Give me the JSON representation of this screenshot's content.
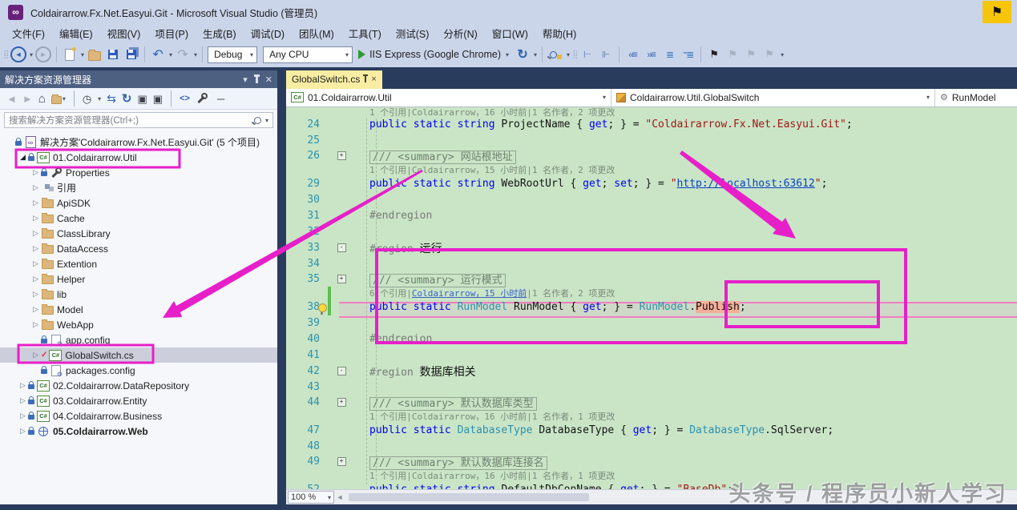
{
  "title_bar": {
    "title": "Coldairarrow.Fx.Net.Easyui.Git - Microsoft Visual Studio (管理员)"
  },
  "menu": [
    "文件(F)",
    "编辑(E)",
    "视图(V)",
    "项目(P)",
    "生成(B)",
    "调试(D)",
    "团队(M)",
    "工具(T)",
    "测试(S)",
    "分析(N)",
    "窗口(W)",
    "帮助(H)"
  ],
  "toolbar": {
    "configuration": "Debug",
    "platform": "Any CPU",
    "run_label": "IIS Express (Google Chrome)"
  },
  "solution_explorer": {
    "title": "解决方案资源管理器",
    "search_placeholder": "搜索解决方案资源管理器(Ctrl+;)",
    "tree": [
      {
        "label": "解决方案'Coldairarrow.Fx.Net.Easyui.Git' (5 个项目)",
        "icon": "sol",
        "level": 0,
        "exp": "",
        "lock": true
      },
      {
        "label": "01.Coldairarrow.Util",
        "icon": "csproj",
        "level": 1,
        "exp": "open",
        "lock": true
      },
      {
        "label": "Properties",
        "icon": "wrench",
        "level": 2,
        "exp": "closed",
        "lock": true
      },
      {
        "label": "引用",
        "icon": "refs",
        "level": 2,
        "exp": "closed"
      },
      {
        "label": "ApiSDK",
        "icon": "folder",
        "level": 2,
        "exp": "closed"
      },
      {
        "label": "Cache",
        "icon": "folder",
        "level": 2,
        "exp": "closed"
      },
      {
        "label": "ClassLibrary",
        "icon": "folder",
        "level": 2,
        "exp": "closed"
      },
      {
        "label": "DataAccess",
        "icon": "folder",
        "level": 2,
        "exp": "closed"
      },
      {
        "label": "Extention",
        "icon": "folder",
        "level": 2,
        "exp": "closed"
      },
      {
        "label": "Helper",
        "icon": "folder",
        "level": 2,
        "exp": "closed"
      },
      {
        "label": "lib",
        "icon": "folder",
        "level": 2,
        "exp": "closed"
      },
      {
        "label": "Model",
        "icon": "folder",
        "level": 2,
        "exp": "closed"
      },
      {
        "label": "WebApp",
        "icon": "folder",
        "level": 2,
        "exp": "closed"
      },
      {
        "label": "app.config",
        "icon": "config",
        "level": 2,
        "exp": "",
        "lock": true
      },
      {
        "label": "GlobalSwitch.cs",
        "icon": "cs",
        "level": 2,
        "exp": "closed",
        "check": true,
        "selected": true
      },
      {
        "label": "packages.config",
        "icon": "config",
        "level": 2,
        "exp": "",
        "lock": true
      },
      {
        "label": "02.Coldairarrow.DataRepository",
        "icon": "csproj",
        "level": 1,
        "exp": "closed",
        "lock": true
      },
      {
        "label": "03.Coldairarrow.Entity",
        "icon": "csproj",
        "level": 1,
        "exp": "closed",
        "lock": true
      },
      {
        "label": "04.Coldairarrow.Business",
        "icon": "csproj",
        "level": 1,
        "exp": "closed",
        "lock": true
      },
      {
        "label": "05.Coldairarrow.Web",
        "icon": "web",
        "level": 1,
        "exp": "closed",
        "lock": true,
        "bold": true
      }
    ]
  },
  "editor": {
    "tab": "GlobalSwitch.cs",
    "nav_project": "01.Coldairarrow.Util",
    "nav_type": "Coldairarrow.Util.GlobalSwitch",
    "nav_member": "RunModel",
    "zoom_level": "100 %",
    "rows": [
      {
        "type": "clip",
        "seg": [
          {
            "c": "cl",
            "t": "1 个引用|Coldairarrow，16 小时前|1 名作者，2 项更改"
          }
        ]
      },
      {
        "n": "24",
        "type": "code",
        "seg": [
          {
            "c": "kw",
            "t": "public static string"
          },
          {
            "c": "pl",
            "t": " ProjectName { "
          },
          {
            "c": "kw",
            "t": "get"
          },
          {
            "c": "pl",
            "t": "; } = "
          },
          {
            "c": "str",
            "t": "\"Coldairarrow.Fx.Net.Easyui.Git\""
          },
          {
            "c": "pl",
            "t": ";"
          }
        ]
      },
      {
        "n": "25",
        "type": "blank"
      },
      {
        "n": "26",
        "type": "summary",
        "fold": "+",
        "seg": [
          {
            "c": "cm",
            "t": "/// <summary> 网站根地址"
          }
        ]
      },
      {
        "type": "codelens",
        "seg": [
          {
            "c": "cl",
            "t": "1 个引用|Coldairarrow，15 小时前|1 名作者，2 项更改"
          }
        ]
      },
      {
        "n": "29",
        "type": "code",
        "seg": [
          {
            "c": "kw",
            "t": "public static string"
          },
          {
            "c": "pl",
            "t": " WebRootUrl { "
          },
          {
            "c": "kw",
            "t": "get"
          },
          {
            "c": "pl",
            "t": "; "
          },
          {
            "c": "kw",
            "t": "set"
          },
          {
            "c": "pl",
            "t": "; } = "
          },
          {
            "c": "str",
            "t": "\""
          },
          {
            "c": "url",
            "t": "http://localhost:63612"
          },
          {
            "c": "str",
            "t": "\""
          },
          {
            "c": "pl",
            "t": ";"
          }
        ]
      },
      {
        "n": "30",
        "type": "blank"
      },
      {
        "n": "31",
        "type": "code",
        "seg": [
          {
            "c": "pre",
            "t": "#endregion"
          }
        ]
      },
      {
        "n": "32",
        "type": "blank"
      },
      {
        "n": "33",
        "type": "code",
        "fold": "-",
        "seg": [
          {
            "c": "pre",
            "t": "#region "
          },
          {
            "c": "cjk",
            "t": "运行"
          }
        ]
      },
      {
        "n": "34",
        "type": "blank"
      },
      {
        "n": "35",
        "type": "summary",
        "fold": "+",
        "seg": [
          {
            "c": "cm",
            "t": "/// <summary> 运行模式"
          }
        ]
      },
      {
        "type": "codelens",
        "bar": true,
        "seg": [
          {
            "c": "cl",
            "t": "6 个引用|"
          },
          {
            "c": "cll",
            "t": "Coldairarrow，15 小时前"
          },
          {
            "c": "cl",
            "t": "|1 名作者，2 项更改"
          }
        ]
      },
      {
        "n": "38",
        "type": "code",
        "bar": true,
        "bulb": true,
        "seg": [
          {
            "c": "kw",
            "t": "public static "
          },
          {
            "c": "ty",
            "t": "RunModel"
          },
          {
            "c": "pl",
            "t": " RunModel { "
          },
          {
            "c": "kw",
            "t": "get"
          },
          {
            "c": "pl",
            "t": "; } = "
          },
          {
            "c": "ty",
            "t": "RunModel"
          },
          {
            "c": "pl",
            "t": "."
          },
          {
            "c": "hl",
            "t": "Publish"
          },
          {
            "c": "pl",
            "t": ";"
          }
        ]
      },
      {
        "n": "39",
        "type": "blank"
      },
      {
        "n": "40",
        "type": "code",
        "seg": [
          {
            "c": "pre",
            "t": "#endregion"
          }
        ]
      },
      {
        "n": "41",
        "type": "blank"
      },
      {
        "n": "42",
        "type": "code",
        "fold": "-",
        "seg": [
          {
            "c": "pre",
            "t": "#region "
          },
          {
            "c": "cjk",
            "t": "数据库相关"
          }
        ]
      },
      {
        "n": "43",
        "type": "blank"
      },
      {
        "n": "44",
        "type": "summary",
        "fold": "+",
        "seg": [
          {
            "c": "cm",
            "t": "/// <summary> 默认数据库类型"
          }
        ]
      },
      {
        "type": "codelens",
        "seg": [
          {
            "c": "cl",
            "t": "1 个引用|Coldairarrow，16 小时前|1 名作者，1 项更改"
          }
        ]
      },
      {
        "n": "47",
        "type": "code",
        "seg": [
          {
            "c": "kw",
            "t": "public static "
          },
          {
            "c": "ty",
            "t": "DatabaseType"
          },
          {
            "c": "pl",
            "t": " DatabaseType { "
          },
          {
            "c": "kw",
            "t": "get"
          },
          {
            "c": "pl",
            "t": "; } = "
          },
          {
            "c": "ty",
            "t": "DatabaseType"
          },
          {
            "c": "pl",
            "t": ".SqlServer;"
          }
        ]
      },
      {
        "n": "48",
        "type": "blank"
      },
      {
        "n": "49",
        "type": "summary",
        "fold": "+",
        "seg": [
          {
            "c": "cm",
            "t": "/// <summary> 默认数据库连接名"
          }
        ]
      },
      {
        "type": "codelens",
        "seg": [
          {
            "c": "cl",
            "t": "1 个引用|Coldairarrow，16 小时前|1 名作者，1 项更改"
          }
        ]
      },
      {
        "n": "52",
        "type": "code",
        "seg": [
          {
            "c": "kw",
            "t": "public static string"
          },
          {
            "c": "pl",
            "t": " DefaultDbConName { "
          },
          {
            "c": "kw",
            "t": "get"
          },
          {
            "c": "pl",
            "t": "; } = "
          },
          {
            "c": "str",
            "t": "\"BaseDb\""
          },
          {
            "c": "pl",
            "t": ";"
          }
        ]
      }
    ]
  },
  "watermark": "头条号 / 程序员小新人学习",
  "colors": {
    "annotation": "#E71FC9",
    "editor_background": "#C9E5C6",
    "chrome_background": "#CBD5EA",
    "window_background": "#2A3C5E",
    "active_tab": "#F8EDA2",
    "publish_highlight": "#F4AF9B",
    "change_bar": "#5BBE4D"
  }
}
